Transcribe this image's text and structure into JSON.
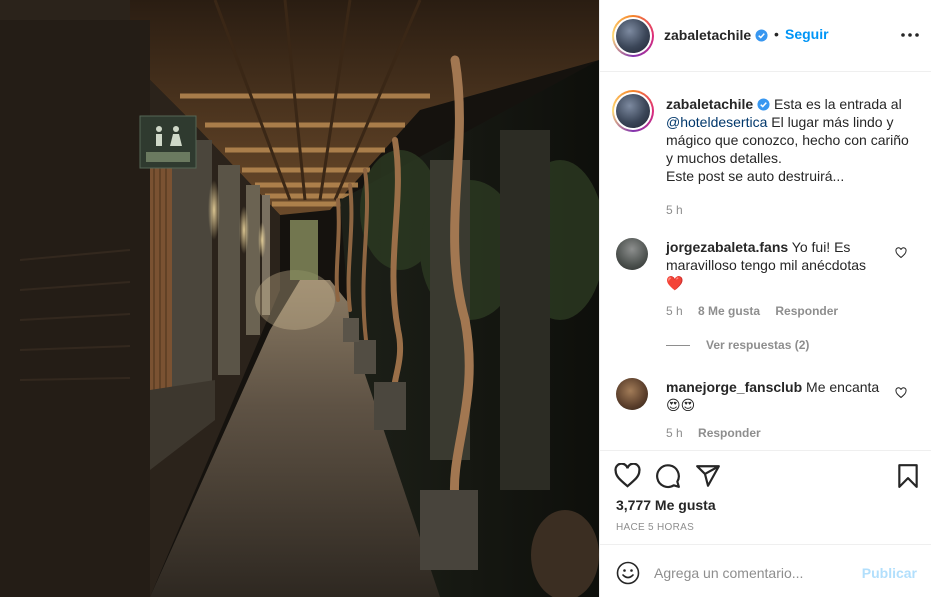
{
  "post": {
    "username": "zabaletachile",
    "follow_label": "Seguir",
    "dot": "•",
    "more_icon": "more-horizontal-icon"
  },
  "caption": {
    "username": "zabaletachile",
    "text_before": "Esta es la entrada al",
    "mention": "@hoteldesertica",
    "text_after": "El lugar más lindo y mágico que conozco, hecho con cariño y muchos detalles.",
    "text_line2": "Este post se auto destruirá...",
    "time": "5 h"
  },
  "comments": [
    {
      "username": "jorgezabaleta.fans",
      "text": "Yo fui! Es maravilloso tengo mil anécdotas",
      "emoji": "❤️",
      "time": "5 h",
      "likes": "8 Me gusta",
      "reply": "Responder",
      "view_replies": "Ver respuestas (2)"
    },
    {
      "username": "manejorge_fansclub",
      "text": "Me encanta",
      "emoji": "😍😍",
      "time": "5 h",
      "reply": "Responder"
    }
  ],
  "stats": {
    "likes": "3,777 Me gusta",
    "posted": "HACE 5 HORAS"
  },
  "composer": {
    "placeholder": "Agrega un comentario...",
    "publish": "Publicar"
  },
  "colors": {
    "link_blue": "#0095f6",
    "mention_blue": "#00376b",
    "muted": "#8e8e8e",
    "verified_blue": "#3897f0",
    "publish_disabled": "#b2dffc"
  }
}
